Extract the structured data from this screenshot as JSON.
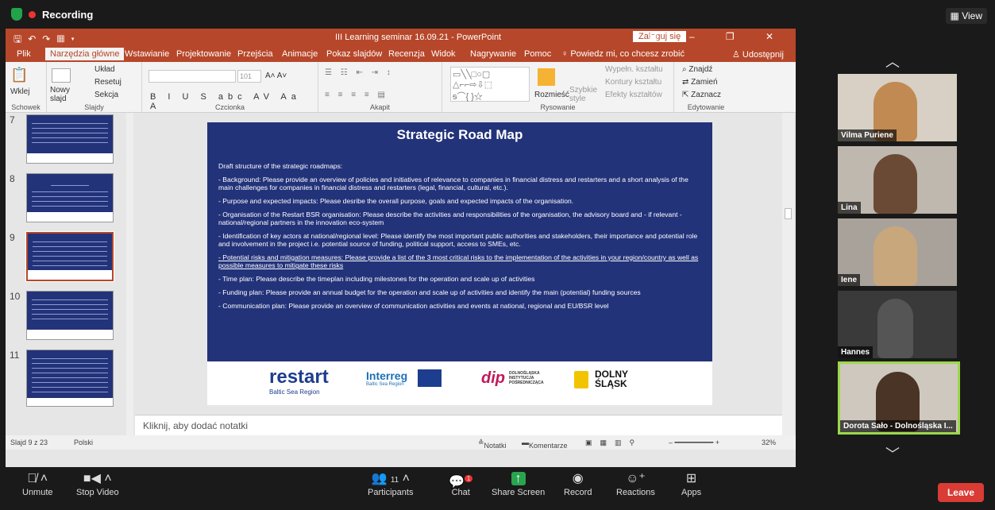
{
  "zoom": {
    "recording_label": "Recording",
    "view_label": "View",
    "toolbar": {
      "unmute": "Unmute",
      "stop_video": "Stop Video",
      "participants": "Participants",
      "participants_count": "11",
      "chat": "Chat",
      "chat_badge": "1",
      "share_screen": "Share Screen",
      "record": "Record",
      "reactions": "Reactions",
      "apps": "Apps",
      "leave": "Leave"
    },
    "participants_videos": [
      {
        "name": "Vilma Puriene"
      },
      {
        "name": "Lina"
      },
      {
        "name": "Iene"
      },
      {
        "name": "Hannes"
      },
      {
        "name": "Dorota Sało - Dolnośląska I..."
      }
    ]
  },
  "ppt": {
    "window_title": "III Learning seminar 16.09.21 - PowerPoint",
    "login_button": "Zaloguj się",
    "tabs": [
      "Plik",
      "Narzędzia główne",
      "Wstawianie",
      "Projektowanie",
      "Przejścia",
      "Animacje",
      "Pokaz slajdów",
      "Recenzja",
      "Widok",
      "Nagrywanie",
      "Pomoc"
    ],
    "tell_me": "Powiedz mi, co chcesz zrobić",
    "share": "Udostępnij",
    "ribbon_groups": [
      "Schowek",
      "Slajdy",
      "Czcionka",
      "Akapit",
      "Rysowanie",
      "Edytowanie"
    ],
    "ribbon_buttons": {
      "paste": "Wklej",
      "new_slide": "Nowy slajd",
      "layout": "Układ",
      "reset": "Resetuj",
      "section": "Sekcja",
      "font_size": "101",
      "arrange": "Rozmieść",
      "quick_styles": "Szybkie style",
      "fill": "Wypełn. kształtu",
      "outline": "Kontury kształtu",
      "effects": "Efekty kształtów",
      "find": "Znajdź",
      "replace": "Zamień",
      "select": "Zaznacz"
    },
    "thumbnail_numbers": [
      "7",
      "8",
      "9",
      "10",
      "11"
    ],
    "slide": {
      "title": "Strategic Road Map",
      "paragraphs": [
        "Draft structure of the strategic roadmaps:",
        "- Background: Please provide an overview of policies and initiatives of relevance to companies in financial distress and restarters and a short analysis of the main challenges for companies in financial distress and restarters (legal, financial, cultural, etc.).",
        "- Purpose and expected impacts: Please desribe the overall purpose, goals and expected impacts of the organisation.",
        "- Organisation of the Restart BSR organisation: Please describe the activities and responsibilities of the organisation, the advisory board and - if relevant - national/regional partners in the innovation eco-system",
        "- Identification of key actors at national/regional level: Please identify the most important public authorities and stakeholders, their importance and potential role and involvement in the project i.e. potential source of funding, political support, access to SMEs, etc.",
        "- Potential risks and mitigation measures: Please provide a list of the 3 most critical risks to the implementation of the activities in your region/country as well as possible measures to mitigate these risks",
        "- Time plan: Please describe the timeplan including milestones for the operation and scale up of activities",
        "- Funding plan: Please provide an annual budget for the operation and scale up of activities and identify the main (potential) funding sources",
        "- Communication plan: Please provide an overview of communication activities and events at national, regional and EU/BSR level"
      ],
      "logos": {
        "restart": "restart",
        "restart_sub": "Baltic Sea Region",
        "interreg": "Interreg",
        "interreg_sub": "Baltic Sea Region",
        "dip": "dip",
        "dip_text": "DOLNOŚLĄSKA INSTYTUCJA POŚREDNICZĄCA",
        "dolny": "DOLNY ŚLĄSK"
      }
    },
    "notes_placeholder": "Kliknij, aby dodać notatki",
    "status": {
      "slide_of": "Slajd 9 z 23",
      "language": "Polski",
      "notes": "Notatki",
      "comments": "Komentarze",
      "zoom": "32%"
    }
  }
}
